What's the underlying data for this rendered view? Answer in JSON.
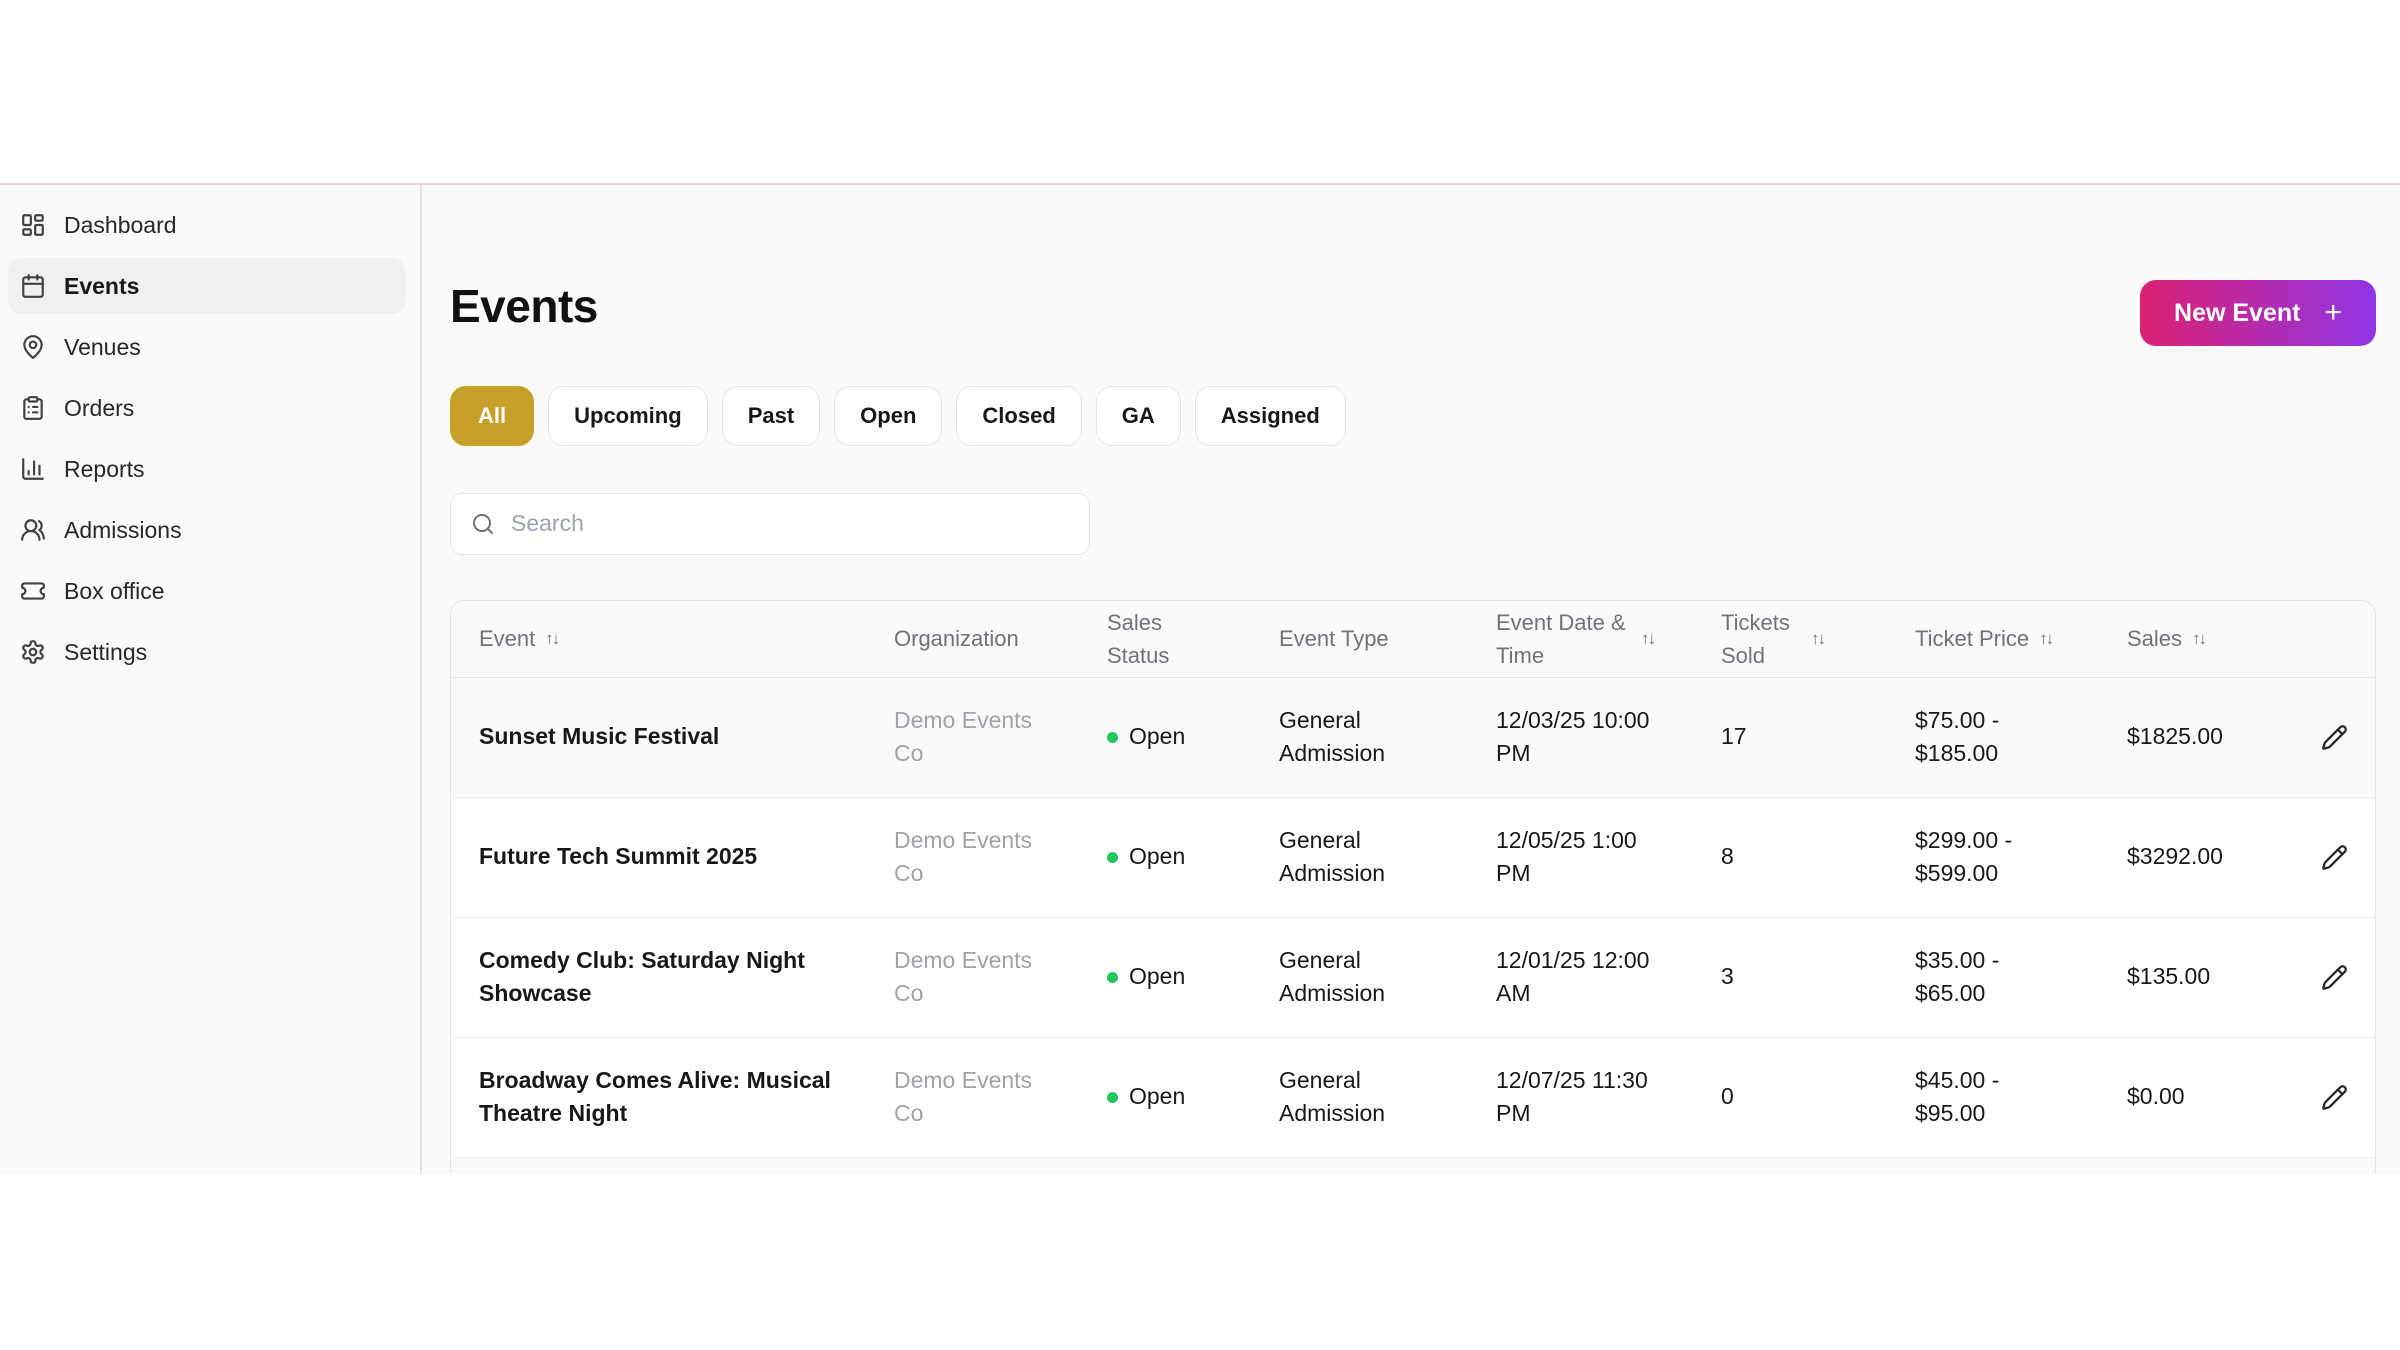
{
  "sidebar": {
    "items": [
      {
        "label": "Dashboard",
        "icon": "dashboard-icon",
        "active": false
      },
      {
        "label": "Events",
        "icon": "calendar-icon",
        "active": true
      },
      {
        "label": "Venues",
        "icon": "map-pin-icon",
        "active": false
      },
      {
        "label": "Orders",
        "icon": "clipboard-icon",
        "active": false
      },
      {
        "label": "Reports",
        "icon": "bar-chart-icon",
        "active": false
      },
      {
        "label": "Admissions",
        "icon": "users-icon",
        "active": false
      },
      {
        "label": "Box office",
        "icon": "ticket-icon",
        "active": false
      },
      {
        "label": "Settings",
        "icon": "gear-icon",
        "active": false
      }
    ]
  },
  "header": {
    "title": "Events",
    "new_event_label": "New Event",
    "plus_glyph": "+"
  },
  "filters": [
    {
      "label": "All",
      "active": true
    },
    {
      "label": "Upcoming",
      "active": false
    },
    {
      "label": "Past",
      "active": false
    },
    {
      "label": "Open",
      "active": false
    },
    {
      "label": "Closed",
      "active": false
    },
    {
      "label": "GA",
      "active": false
    },
    {
      "label": "Assigned",
      "active": false
    }
  ],
  "search": {
    "placeholder": "Search",
    "icon": "search-icon"
  },
  "table": {
    "sort_glyph": "↑↓",
    "columns": {
      "event": {
        "label": "Event",
        "sortable": true
      },
      "organization": {
        "label": "Organization",
        "sortable": false
      },
      "sales_status": {
        "label": "Sales Status",
        "sortable": false
      },
      "event_type": {
        "label": "Event Type",
        "sortable": false
      },
      "datetime": {
        "label": "Event Date & Time",
        "sortable": true
      },
      "tickets_sold": {
        "label": "Tickets Sold",
        "sortable": true
      },
      "ticket_price": {
        "label": "Ticket Price",
        "sortable": true
      },
      "sales": {
        "label": "Sales",
        "sortable": true
      }
    },
    "rows": [
      {
        "event": "Sunset Music Festival",
        "organization": "Demo Events Co",
        "sales_status": "Open",
        "event_type": "General Admission",
        "datetime": "12/03/25 10:00 PM",
        "tickets_sold": "17",
        "ticket_price": "$75.00 - $185.00",
        "sales": "$1825.00"
      },
      {
        "event": "Future Tech Summit 2025",
        "organization": "Demo Events Co",
        "sales_status": "Open",
        "event_type": "General Admission",
        "datetime": "12/05/25 1:00 PM",
        "tickets_sold": "8",
        "ticket_price": "$299.00 - $599.00",
        "sales": "$3292.00"
      },
      {
        "event": "Comedy Club: Saturday Night Showcase",
        "organization": "Demo Events Co",
        "sales_status": "Open",
        "event_type": "General Admission",
        "datetime": "12/01/25 12:00 AM",
        "tickets_sold": "3",
        "ticket_price": "$35.00 - $65.00",
        "sales": "$135.00"
      },
      {
        "event": "Broadway Comes Alive: Musical Theatre Night",
        "organization": "Demo Events Co",
        "sales_status": "Open",
        "event_type": "General Admission",
        "datetime": "12/07/25 11:30 PM",
        "tickets_sold": "0",
        "ticket_price": "$45.00 - $95.00",
        "sales": "$0.00"
      }
    ]
  },
  "colors": {
    "accent_gold": "#c6a028",
    "button_gradient_start": "#dc2174",
    "button_gradient_end": "#8f35e5",
    "status_green": "#22c55e",
    "top_divider_pink": "#f4ccd4",
    "header_text_gray": "#71717a",
    "muted_text_gray": "#a1a1aa"
  }
}
